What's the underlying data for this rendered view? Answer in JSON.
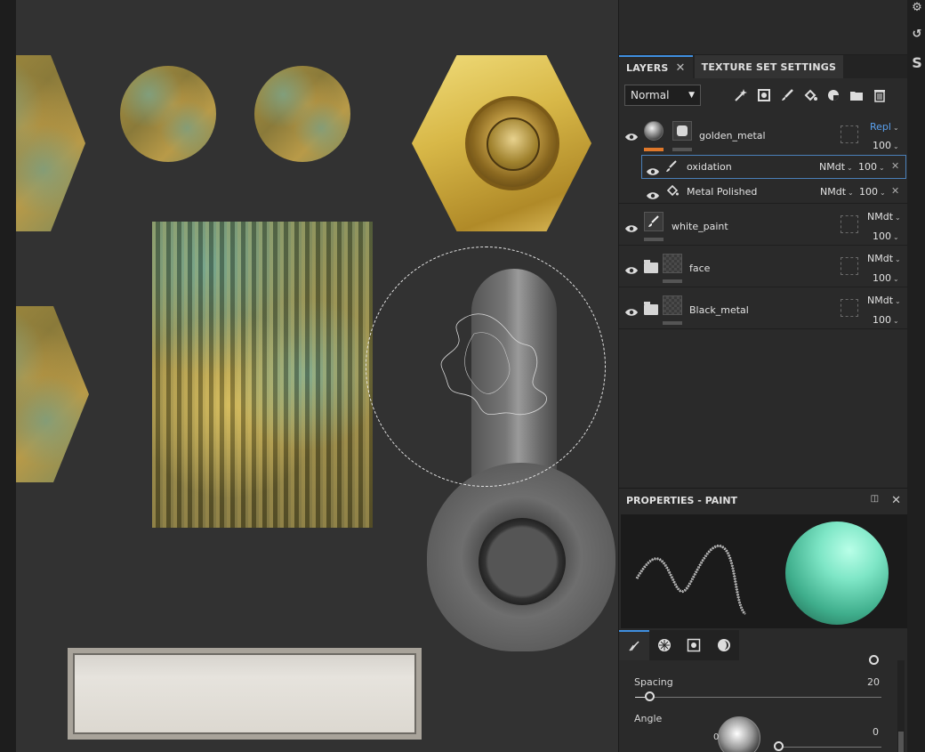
{
  "layers_panel": {
    "tab_layers": "LAYERS",
    "tab_close": "✕",
    "tab_texture_set": "TEXTURE SET SETTINGS",
    "blend_mode": "Normal",
    "layers": [
      {
        "name": "golden_metal",
        "mode": "Repl",
        "opacity": "100"
      },
      {
        "name": "oxidation",
        "mode": "NMdt",
        "opacity": "100"
      },
      {
        "name": "Metal Polished",
        "mode": "NMdt",
        "opacity": "100"
      },
      {
        "name": "white_paint",
        "mode": "NMdt",
        "opacity": "100"
      },
      {
        "name": "face",
        "mode": "NMdt",
        "opacity": "100"
      },
      {
        "name": "Black_metal",
        "mode": "NMdt",
        "opacity": "100"
      }
    ]
  },
  "properties": {
    "title": "PROPERTIES - PAINT",
    "sphere_color": "#7ee6c6",
    "spacing_label": "Spacing",
    "spacing_value": "20",
    "angle_label": "Angle",
    "angle_value": "0",
    "dial_zero": "0"
  },
  "colors": {
    "accent": "#3f8fe0",
    "orange_bar": "#e0782a",
    "blend_blue": "#5aa0ee"
  }
}
